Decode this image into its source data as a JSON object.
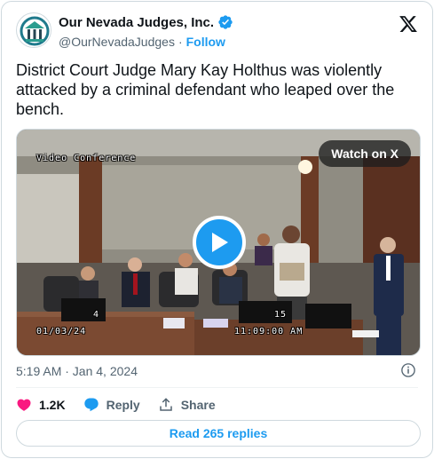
{
  "account": {
    "name": "Our Nevada Judges, Inc.",
    "handle": "@OurNevadaJudges",
    "separator": "·",
    "follow_label": "Follow"
  },
  "tweet": {
    "text": "District Court Judge Mary Kay Holthus was violently attacked by a criminal defendant who leaped over the bench."
  },
  "video": {
    "watch_label": "Watch on X",
    "overlay_title": "Video Conference",
    "overlay_date": "01/03/24",
    "overlay_time": "11:09:00 AM",
    "overlay_cam_left": "4",
    "overlay_cam_right": "15"
  },
  "meta": {
    "timestamp": "5:19 AM · Jan 4, 2024"
  },
  "actions": {
    "like_count": "1.2K",
    "reply_label": "Reply",
    "share_label": "Share"
  },
  "read_replies_label": "Read 265 replies",
  "colors": {
    "accent": "#1d9bf0",
    "like": "#f91880",
    "text_secondary": "#536471"
  }
}
